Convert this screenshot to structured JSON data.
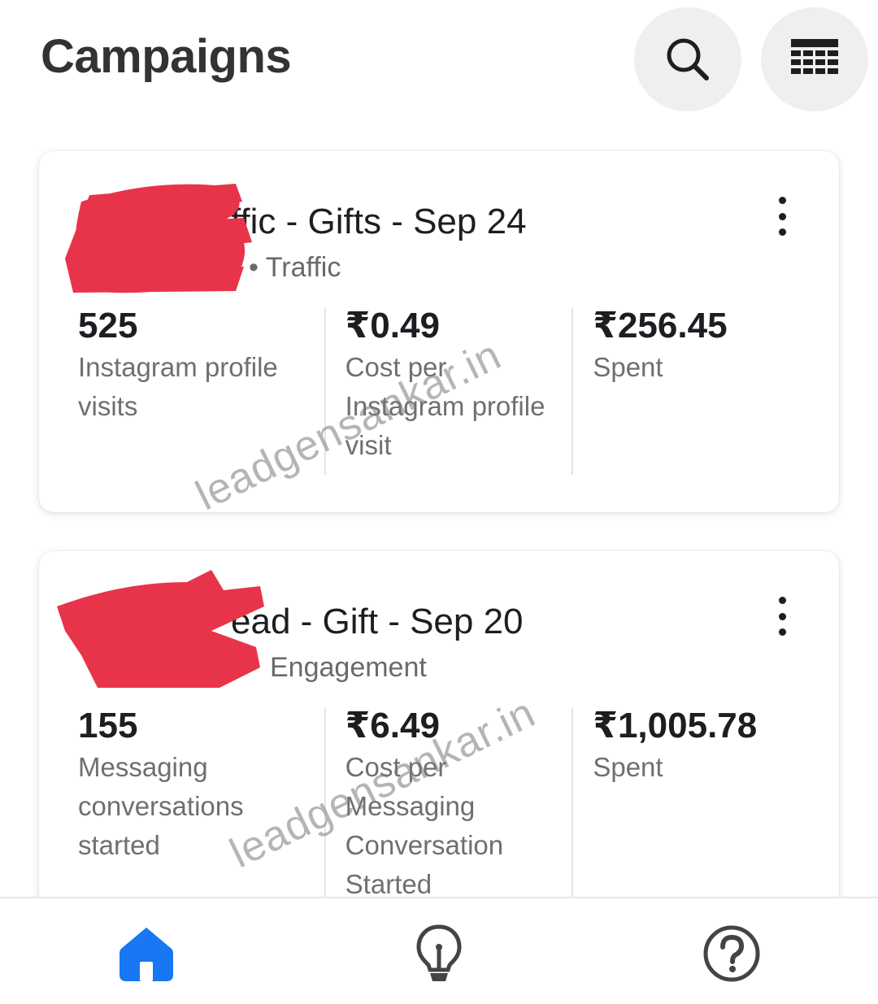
{
  "header": {
    "title": "Campaigns",
    "search_icon": "search-icon",
    "table_icon": "table-columns-icon"
  },
  "campaigns": [
    {
      "name_visible": "ffic - Gifts - Sep 24",
      "objective": "Traffic",
      "metrics": [
        {
          "value": "525",
          "label": "Instagram profile visits"
        },
        {
          "value": "₹0.49",
          "label": "Cost per Instagram profile visit"
        },
        {
          "value": "₹256.45",
          "label": "Spent"
        }
      ]
    },
    {
      "name_visible": "ead - Gift - Sep 20",
      "objective": "Engagement",
      "metrics": [
        {
          "value": "155",
          "label": "Messaging conversations started"
        },
        {
          "value": "₹6.49",
          "label": "Cost per Messaging Conversation Started"
        },
        {
          "value": "₹1,005.78",
          "label": "Spent"
        }
      ]
    }
  ],
  "watermark": "leadgensankar.in",
  "bottom_nav": {
    "items": [
      {
        "icon": "home-icon",
        "active": true
      },
      {
        "icon": "lightbulb-icon",
        "active": false
      },
      {
        "icon": "help-icon",
        "active": false
      }
    ]
  },
  "colors": {
    "accent": "#1877f2",
    "redaction": "#e8344a",
    "text": "#1c1e21",
    "muted": "#6f6f6f"
  }
}
